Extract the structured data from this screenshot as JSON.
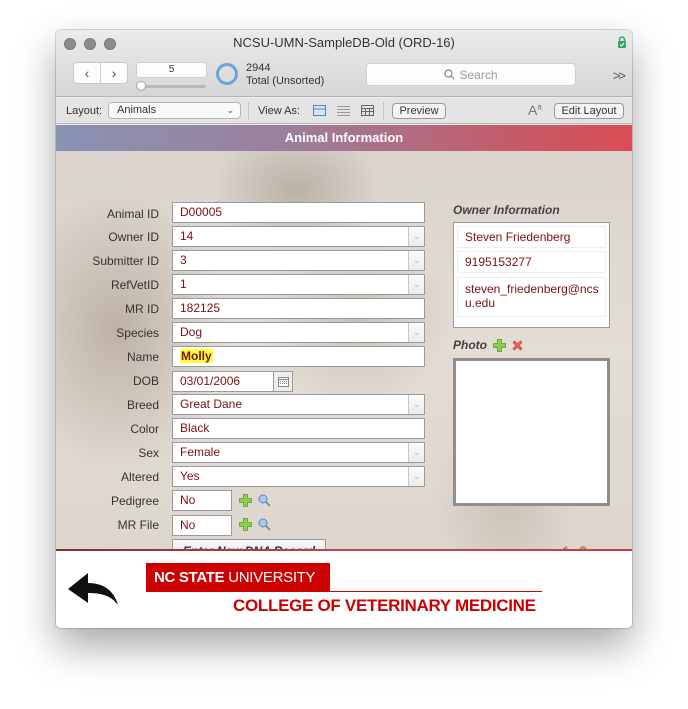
{
  "window": {
    "title": "NCSU-UMN-SampleDB-Old (ORD-16)"
  },
  "toolbar": {
    "prev_icon": "chevron-left-icon",
    "next_icon": "chevron-right-icon",
    "record_number": "5",
    "found_count": "2944",
    "found_label": "Total (Unsorted)",
    "search_placeholder": "Search",
    "more_label": ">>"
  },
  "layout_bar": {
    "layout_label": "Layout:",
    "layout_value": "Animals",
    "view_as_label": "View As:",
    "view_modes": [
      "form-view-icon",
      "list-view-icon",
      "table-view-icon"
    ],
    "active_view": "form-view-icon",
    "preview_label": "Preview",
    "text_format_icon": "Aa",
    "edit_layout_label": "Edit Layout"
  },
  "header": {
    "title": "Animal Information"
  },
  "form": {
    "fields": [
      {
        "label": "Animal ID",
        "value": "D00005",
        "type": "text"
      },
      {
        "label": "Owner ID",
        "value": "14",
        "type": "dropdown"
      },
      {
        "label": "Submitter ID",
        "value": "3",
        "type": "dropdown"
      },
      {
        "label": "RefVetID",
        "value": "1",
        "type": "dropdown"
      },
      {
        "label": "MR ID",
        "value": "182125",
        "type": "text"
      },
      {
        "label": "Species",
        "value": "Dog",
        "type": "dropdown"
      },
      {
        "label": "Name",
        "value": "Molly",
        "type": "text",
        "highlighted": true
      },
      {
        "label": "DOB",
        "value": "03/01/2006",
        "type": "date"
      },
      {
        "label": "Breed",
        "value": "Great Dane",
        "type": "dropdown"
      },
      {
        "label": "Color",
        "value": "Black",
        "type": "text"
      },
      {
        "label": "Sex",
        "value": "Female",
        "type": "dropdown"
      },
      {
        "label": "Altered",
        "value": "Yes",
        "type": "dropdown"
      },
      {
        "label": "Pedigree",
        "value": "No",
        "type": "file"
      },
      {
        "label": "MR File",
        "value": "No",
        "type": "file"
      }
    ],
    "dna_button_label": "Enter New DNA Record"
  },
  "owner": {
    "title": "Owner Information",
    "name": "Steven Friedenberg",
    "phone": "9195153277",
    "email": "steven_friedenberg@ncsu.edu"
  },
  "photo": {
    "title": "Photo"
  },
  "footer": {
    "ncsu_bold": "NC STATE",
    "ncsu_rest": " UNIVERSITY",
    "college": "COLLEGE OF VETERINARY MEDICINE"
  },
  "colors": {
    "value_text": "#7a1010",
    "highlight": "#ffff33",
    "ncsu_red": "#cc0000",
    "banner_start": "#8993b2",
    "banner_end": "#dc4c54",
    "accent_blue": "#6fa1dc"
  }
}
